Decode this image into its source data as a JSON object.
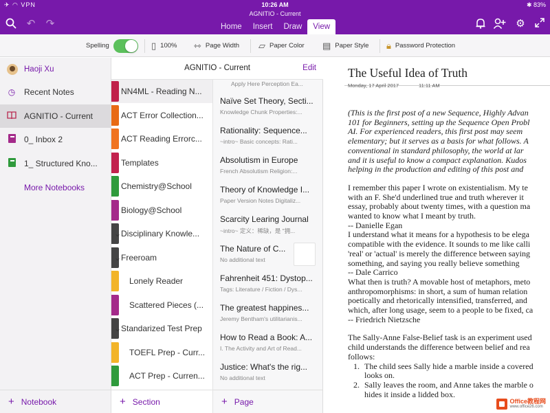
{
  "status": {
    "time": "10:26 AM",
    "left": "✈ ◠ VPN",
    "right": "✱ 83%"
  },
  "app": {
    "title": "AGNITIO - Current"
  },
  "tabs": [
    "Home",
    "Insert",
    "Draw",
    "View"
  ],
  "ribbon": {
    "spelling": "Spelling",
    "zoom": "100%",
    "page_width": "Page Width",
    "paper_color": "Paper Color",
    "paper_style": "Paper Style",
    "password": "Password Protection"
  },
  "user": {
    "name": "Haoji Xu"
  },
  "notebooks": [
    {
      "label": "Recent Notes",
      "icon": "clock-icon"
    },
    {
      "label": "AGNITIO - Current",
      "icon": "book-icon"
    },
    {
      "label": "0_ Inbox 2",
      "icon": "notebook-icon"
    },
    {
      "label": "1_ Structured Kno...",
      "icon": "notebook-icon"
    }
  ],
  "more_notebooks": "More Notebooks",
  "section_header": {
    "title": "AGNITIO - Current",
    "edit": "Edit"
  },
  "sections": [
    {
      "label": "NN4ML - Reading N...",
      "color": "#c0214a"
    },
    {
      "label": "ACT Error Collection...",
      "color": "#e86a14"
    },
    {
      "label": "ACT Reading Errorc...",
      "color": "#f0731f"
    },
    {
      "label": "Templates",
      "color": "#c2214d"
    },
    {
      "label": "Chemistry@School",
      "color": "#2f9a3c"
    },
    {
      "label": "Biology@School",
      "color": "#a42a8a"
    },
    {
      "label": "Disciplinary Knowle...",
      "color": "#444444"
    },
    {
      "label": "Freeroam",
      "color": "#444444"
    },
    {
      "label": "Lonely Reader",
      "color": "#f2b429"
    },
    {
      "label": "Scattered Pieces (...",
      "color": "#a42a8a"
    },
    {
      "label": "Standarized Test Prep",
      "color": "#444444"
    },
    {
      "label": "TOEFL Prep - Curr...",
      "color": "#f2b429"
    },
    {
      "label": "ACT Prep - Curren...",
      "color": "#2f9a3c"
    }
  ],
  "pages_top_sub": "Apply Here  Perception  Ea...",
  "pages": [
    {
      "title": "Naïve Set Theory, Secti...",
      "sub": "Knowledge Chunk Properties:..."
    },
    {
      "title": "Rationality: Sequence...",
      "sub": "~intro~  Basic concepts: Rati..."
    },
    {
      "title": "Absolutism in Europe",
      "sub": "French Absolutism  Religion:..."
    },
    {
      "title": "Theory of Knowledge I...",
      "sub": "Paper Version  Notes Digitaliz..."
    },
    {
      "title": "Scarcity Learing Journal",
      "sub": "~intro~  定义：稀缺，是 \"拥..."
    },
    {
      "title": "The Nature of C...",
      "sub": "No additional text"
    },
    {
      "title": "Fahrenheit 451: Dystop...",
      "sub": "Tags: Literature / Fiction / Dys..."
    },
    {
      "title": "The greatest happines...",
      "sub": "Jeremy Bentham's utilitarianis..."
    },
    {
      "title": "How to Read a Book: A...",
      "sub": "I. The Activity and Art of Read..."
    },
    {
      "title": "Justice: What's the rig...",
      "sub": "No additional text"
    }
  ],
  "footer": {
    "notebook": "Notebook",
    "section": "Section",
    "page": "Page"
  },
  "note": {
    "title": "The Useful Idea of Truth",
    "date": "Monday, 17 April 2017",
    "time": "11:11 AM",
    "intro": [
      "(This is the first post of a new Sequence, Highly Advan",
      "101 for Beginners, setting up the Sequence Open Probl",
      "AI.  For experienced readers, this first post may seem",
      "elementary; but it serves as a basis for what follows.  A",
      "conventional in standard philosophy, the world at lar",
      "and it is useful to know a compact explanation.  Kudos",
      "helping in the production and editing of this post and"
    ],
    "quotes": [
      "I remember this paper I wrote on existentialism. My te",
      "with an F. She'd underlined true and truth wherever it",
      "essay, probably about twenty times, with a question ma",
      "wanted to know what I meant by truth.",
      "-- Danielle Egan",
      "I understand what it means for a hypothesis to be elega",
      "compatible with the evidence. It sounds to me like calli",
      "'real' or 'actual' is merely the difference between saying",
      "something, and saying you really believe something",
      "-- Dale Carrico",
      "What then is truth? A movable host of metaphors, meto",
      "anthropomorphisms: in short, a sum of human relation",
      "poetically and rhetorically intensified, transferred, and",
      "which, after long usage, seem to a people to be fixed, ca",
      "-- Friedrich Nietzsche"
    ],
    "sally": [
      "The Sally-Anne False-Belief task is an experiment used",
      "child understands the difference between belief and rea",
      "follows:"
    ],
    "list": [
      [
        "The child sees Sally hide a marble inside a covered",
        "looks on."
      ],
      [
        "Sally leaves the room, and Anne takes the marble o",
        "hides it inside a lidded box."
      ]
    ]
  },
  "watermark": {
    "line1": "Office教程网",
    "line2": "www.office26.com"
  }
}
